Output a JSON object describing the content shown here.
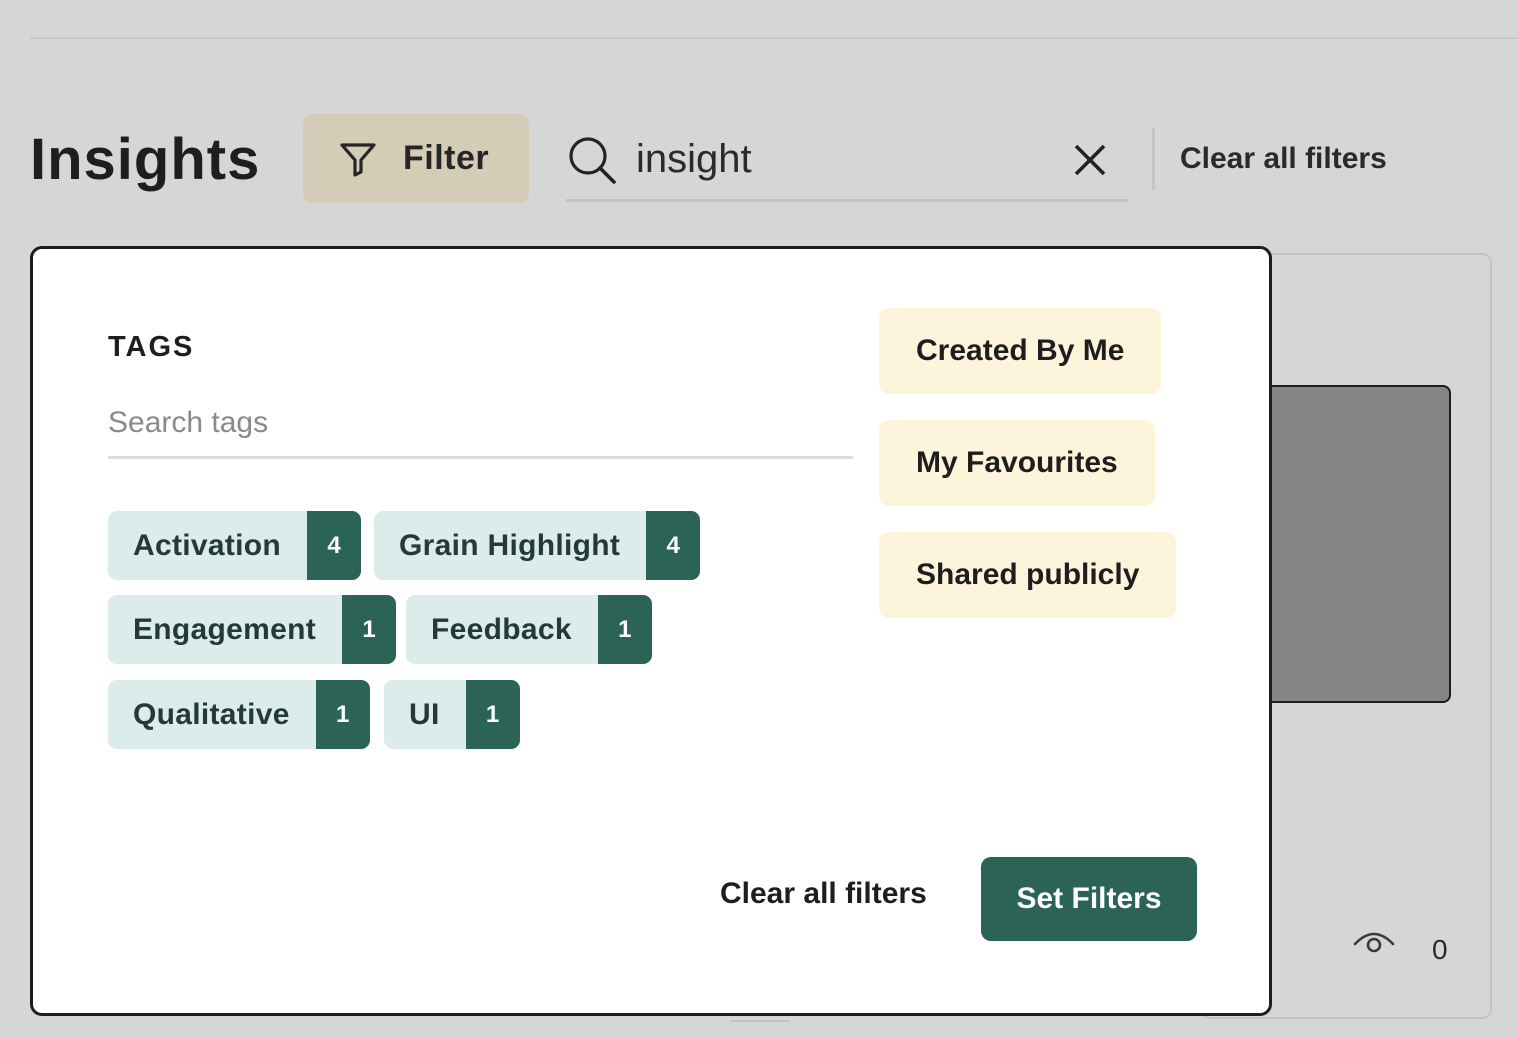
{
  "header": {
    "title": "Insights",
    "filter_button_label": "Filter",
    "search_value": "insight",
    "clear_all_label": "Clear all filters"
  },
  "filter_panel": {
    "tags_heading": "TAGS",
    "tags_search_placeholder": "Search tags",
    "tags": [
      {
        "label": "Activation",
        "count": "4"
      },
      {
        "label": "Grain Highlight",
        "count": "4"
      },
      {
        "label": "Engagement",
        "count": "1"
      },
      {
        "label": "Feedback",
        "count": "1"
      },
      {
        "label": "Qualitative",
        "count": "1"
      },
      {
        "label": "UI",
        "count": "1"
      }
    ],
    "quick_filters": [
      {
        "label": "Created By Me"
      },
      {
        "label": "My Favourites"
      },
      {
        "label": "Shared publicly"
      }
    ],
    "clear_all_label": "Clear all filters",
    "set_filters_label": "Set Filters"
  },
  "background_card": {
    "view_count": "0"
  },
  "colors": {
    "accent_green": "#2b6456",
    "tag_bg": "#dcecea",
    "quick_filter_bg": "#fdf4dc",
    "filter_button_bg": "#d4ccb6",
    "backdrop": "#d6d6d6"
  },
  "icons": {
    "filter": "funnel-icon",
    "search": "magnifier-icon",
    "clear": "close-icon",
    "views": "eye-icon"
  }
}
